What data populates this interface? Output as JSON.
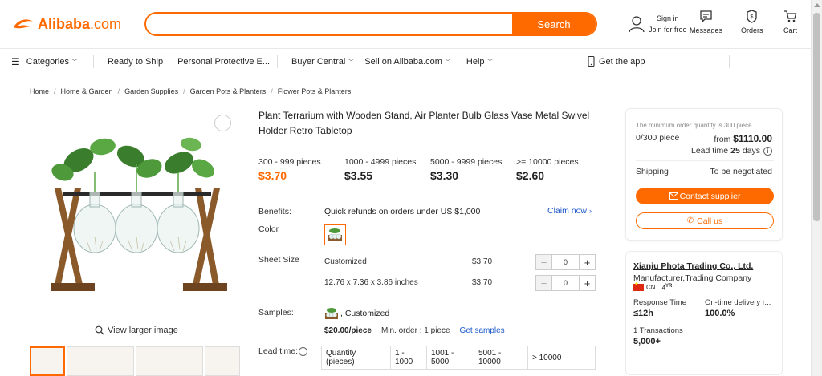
{
  "header": {
    "logo": "Alibaba",
    "logo_suffix": ".com",
    "search_placeholder": "",
    "search_label": "Search",
    "signin_line1": "Sign in",
    "signin_line2": "Join for free",
    "messages_label": "Messages",
    "orders_label": "Orders",
    "cart_label": "Cart"
  },
  "nav": {
    "categories": "Categories",
    "ready_to_ship": "Ready to Ship",
    "ppe": "Personal Protective E...",
    "buyer_central": "Buyer Central",
    "sell": "Sell on Alibaba.com",
    "help": "Help",
    "get_app": "Get the app"
  },
  "breadcrumb": [
    "Home",
    "Home & Garden",
    "Garden Supplies",
    "Garden Pots & Planters",
    "Flower Pots & Planters"
  ],
  "product": {
    "title": "Plant Terrarium with Wooden Stand, Air Planter Bulb Glass Vase Metal Swivel Holder Retro Tabletop",
    "view_larger": "View larger image",
    "tiers": [
      {
        "qty": "300 - 999 pieces",
        "price": "$3.70"
      },
      {
        "qty": "1000 - 4999 pieces",
        "price": "$3.55"
      },
      {
        "qty": "5000 - 9999 pieces",
        "price": "$3.30"
      },
      {
        "qty": ">= 10000 pieces",
        "price": "$2.60"
      }
    ],
    "benefits_label": "Benefits:",
    "benefits_text": "Quick refunds on orders under US $1,000",
    "claim_now": "Claim now",
    "color_label": "Color",
    "sheet_size_label": "Sheet Size",
    "sizes": [
      {
        "name": "Customized",
        "price": "$3.70",
        "qty": "0"
      },
      {
        "name": "12.76 x 7.36 x 3.86 inches",
        "price": "$3.70",
        "qty": "0"
      }
    ],
    "samples_label": "Samples:",
    "samples_option": ", Customized",
    "sample_price": "$20.00/piece",
    "sample_min": "Min. order : 1 piece",
    "get_samples": "Get samples",
    "lead_time_label": "Lead time:",
    "lead_table": [
      "Quantity (pieces)",
      "1 - 1000",
      "1001 - 5000",
      "5001 - 10000",
      "> 10000"
    ]
  },
  "order_card": {
    "min_note": "The minimum order quantity is 300 piece",
    "count": "0/300 piece",
    "from_label": "from",
    "from_price": "$1110.00",
    "lead_label": "Lead time",
    "lead_days": "25",
    "lead_unit": "days",
    "shipping_label": "Shipping",
    "shipping_value": "To be negotiated",
    "contact_label": "Contact supplier",
    "call_label": "Call us"
  },
  "supplier": {
    "name": "Xianju Phota Trading Co., Ltd.",
    "type": "Manufacturer,Trading Company",
    "country": "CN",
    "years": "4",
    "years_suffix": "YR",
    "response_label": "Response Time",
    "response_value": "≤12h",
    "delivery_label": "On-time delivery r...",
    "delivery_value": "100.0%",
    "transactions_label": "1 Transactions",
    "transactions_value": "5,000+"
  },
  "colors": {
    "accent": "#ff6a00",
    "link": "#1a56c8"
  }
}
